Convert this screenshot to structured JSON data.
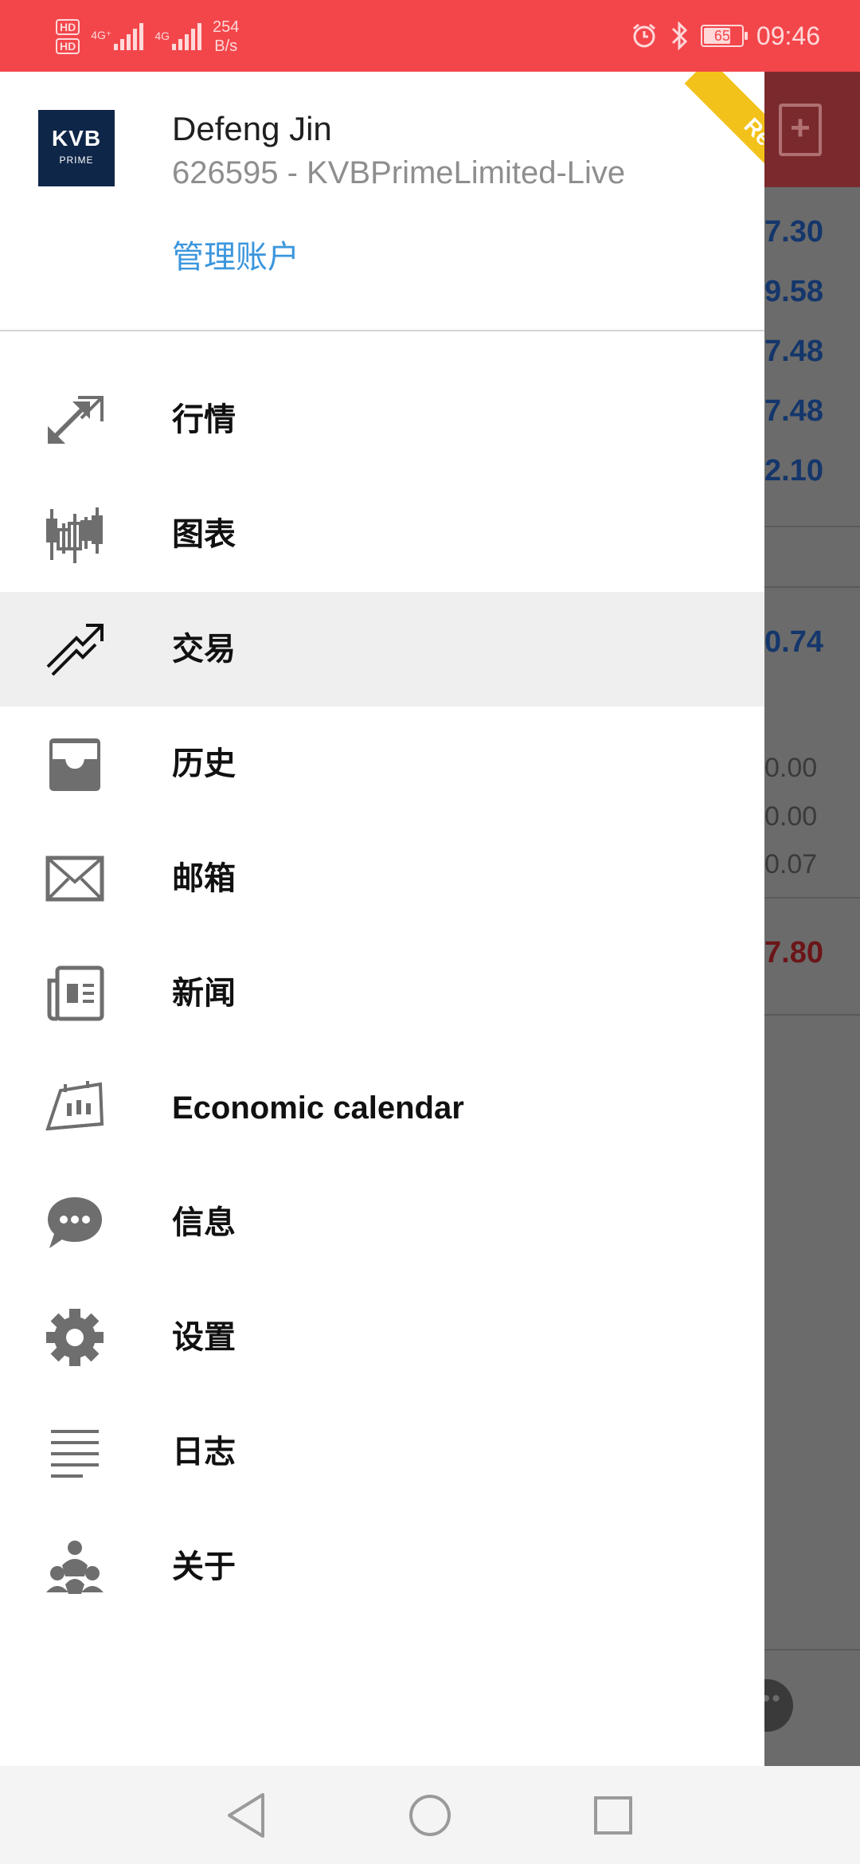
{
  "status_bar": {
    "hd1": "HD",
    "hd2": "HD",
    "net1": "4G⁺",
    "net2": "4G",
    "speed_value": "254",
    "speed_unit": "B/s",
    "battery": "65",
    "time": "09:46",
    "icons": [
      "alarm-icon",
      "bluetooth-icon",
      "battery-icon"
    ]
  },
  "background": {
    "values": [
      "7.30",
      "9.58",
      "7.48",
      "7.48",
      "2.10"
    ],
    "main_value": "0.74",
    "small_values": [
      "0.00",
      "0.00",
      "0.07"
    ],
    "red_value": "7.80"
  },
  "drawer": {
    "badge": "Real",
    "logo": {
      "text": "KVB",
      "sub": "PRIME"
    },
    "user_name": "Defeng Jin",
    "account_line": "626595 - KVBPrimeLimited-Live",
    "manage_label": "管理账户",
    "items": [
      {
        "label": "行情",
        "icon": "quotes-arrows-icon"
      },
      {
        "label": "图表",
        "icon": "candlestick-chart-icon"
      },
      {
        "label": "交易",
        "icon": "trade-trend-icon"
      },
      {
        "label": "历史",
        "icon": "inbox-tray-icon"
      },
      {
        "label": "邮箱",
        "icon": "mail-envelope-icon"
      },
      {
        "label": "新闻",
        "icon": "newspaper-icon"
      },
      {
        "label": "Economic calendar",
        "icon": "economic-calendar-icon"
      },
      {
        "label": "信息",
        "icon": "chat-bubble-icon"
      },
      {
        "label": "设置",
        "icon": "gear-icon"
      },
      {
        "label": "日志",
        "icon": "journal-lines-icon"
      },
      {
        "label": "关于",
        "icon": "about-logo-icon"
      }
    ],
    "active_index": 2
  },
  "colors": {
    "status_bar": "#f3464b",
    "accent_link": "#3b96dd",
    "badge": "#f3c21a",
    "icon_gray": "#6e6e6e",
    "active_row": "#efefef"
  }
}
